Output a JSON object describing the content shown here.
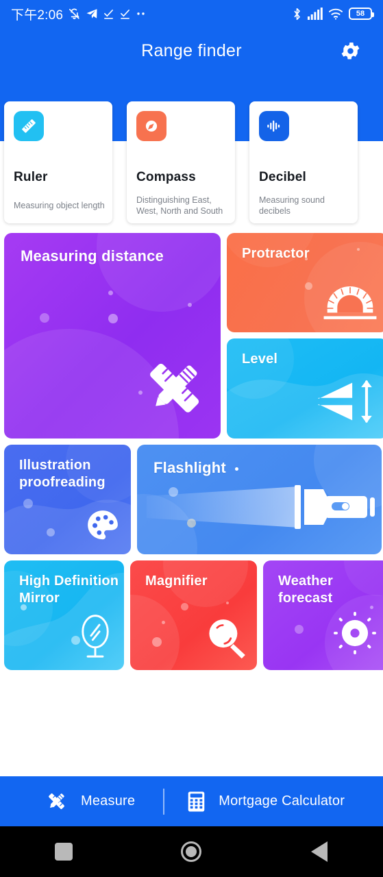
{
  "status_bar": {
    "time": "下午2:06",
    "battery_percent": "58",
    "left_icons": [
      "bell-muted-icon",
      "telegram-send-icon",
      "check-underline-icon",
      "check-underline-icon",
      "more-dots-icon"
    ],
    "right_icons": [
      "bluetooth-icon",
      "signal-bars-icon",
      "wifi-icon",
      "battery-icon"
    ]
  },
  "app_bar": {
    "title": "Range finder",
    "settings_icon": "gear-icon"
  },
  "tools": [
    {
      "name": "Ruler",
      "desc": "Measuring object length",
      "icon": "ruler-icon",
      "icon_bg": "#22c0f2"
    },
    {
      "name": "Compass",
      "desc": "Distinguishing East, West, North and South",
      "icon": "compass-icon",
      "icon_bg": "#f7724f"
    },
    {
      "name": "Decibel",
      "desc": "Measuring sound decibels",
      "icon": "waveform-icon",
      "icon_bg": "#1463e8"
    }
  ],
  "features": [
    {
      "key": "measuring_distance",
      "label": "Measuring distance",
      "icon": "ruler-pencil-icon",
      "color": "#9b34f2"
    },
    {
      "key": "protractor",
      "label": "Protractor",
      "icon": "protractor-icon",
      "color": "#f87352"
    },
    {
      "key": "level",
      "label": "Level",
      "icon": "level-icon",
      "color": "#13b6f3"
    },
    {
      "key": "illustration_proofreading",
      "label": "Illustration proofreading",
      "icon": "palette-icon",
      "color": "#4068ee"
    },
    {
      "key": "flashlight",
      "label": "Flashlight",
      "icon": "flashlight-icon",
      "color": "#4489f0"
    },
    {
      "key": "hd_mirror",
      "label": "High Definition Mirror",
      "icon": "mirror-icon",
      "color": "#16b6f2"
    },
    {
      "key": "magnifier",
      "label": "Magnifier",
      "icon": "magnifier-icon",
      "color": "#f93c3c"
    },
    {
      "key": "weather_forecast",
      "label": "Weather forecast",
      "icon": "sun-icon",
      "color": "#9935f3"
    }
  ],
  "bottom_bar": {
    "items": [
      {
        "label": "Measure",
        "icon": "ruler-pencil-cross-icon"
      },
      {
        "label": "Mortgage Calculator",
        "icon": "calculator-icon"
      }
    ],
    "background": "#1266f1"
  },
  "nav_bar": {
    "buttons": [
      {
        "name": "recents",
        "icon": "square-icon"
      },
      {
        "name": "home",
        "icon": "circle-icon"
      },
      {
        "name": "back",
        "icon": "triangle-left-icon"
      }
    ]
  },
  "theme": {
    "primary": "#1266f1",
    "page_background": "#ffffff"
  }
}
